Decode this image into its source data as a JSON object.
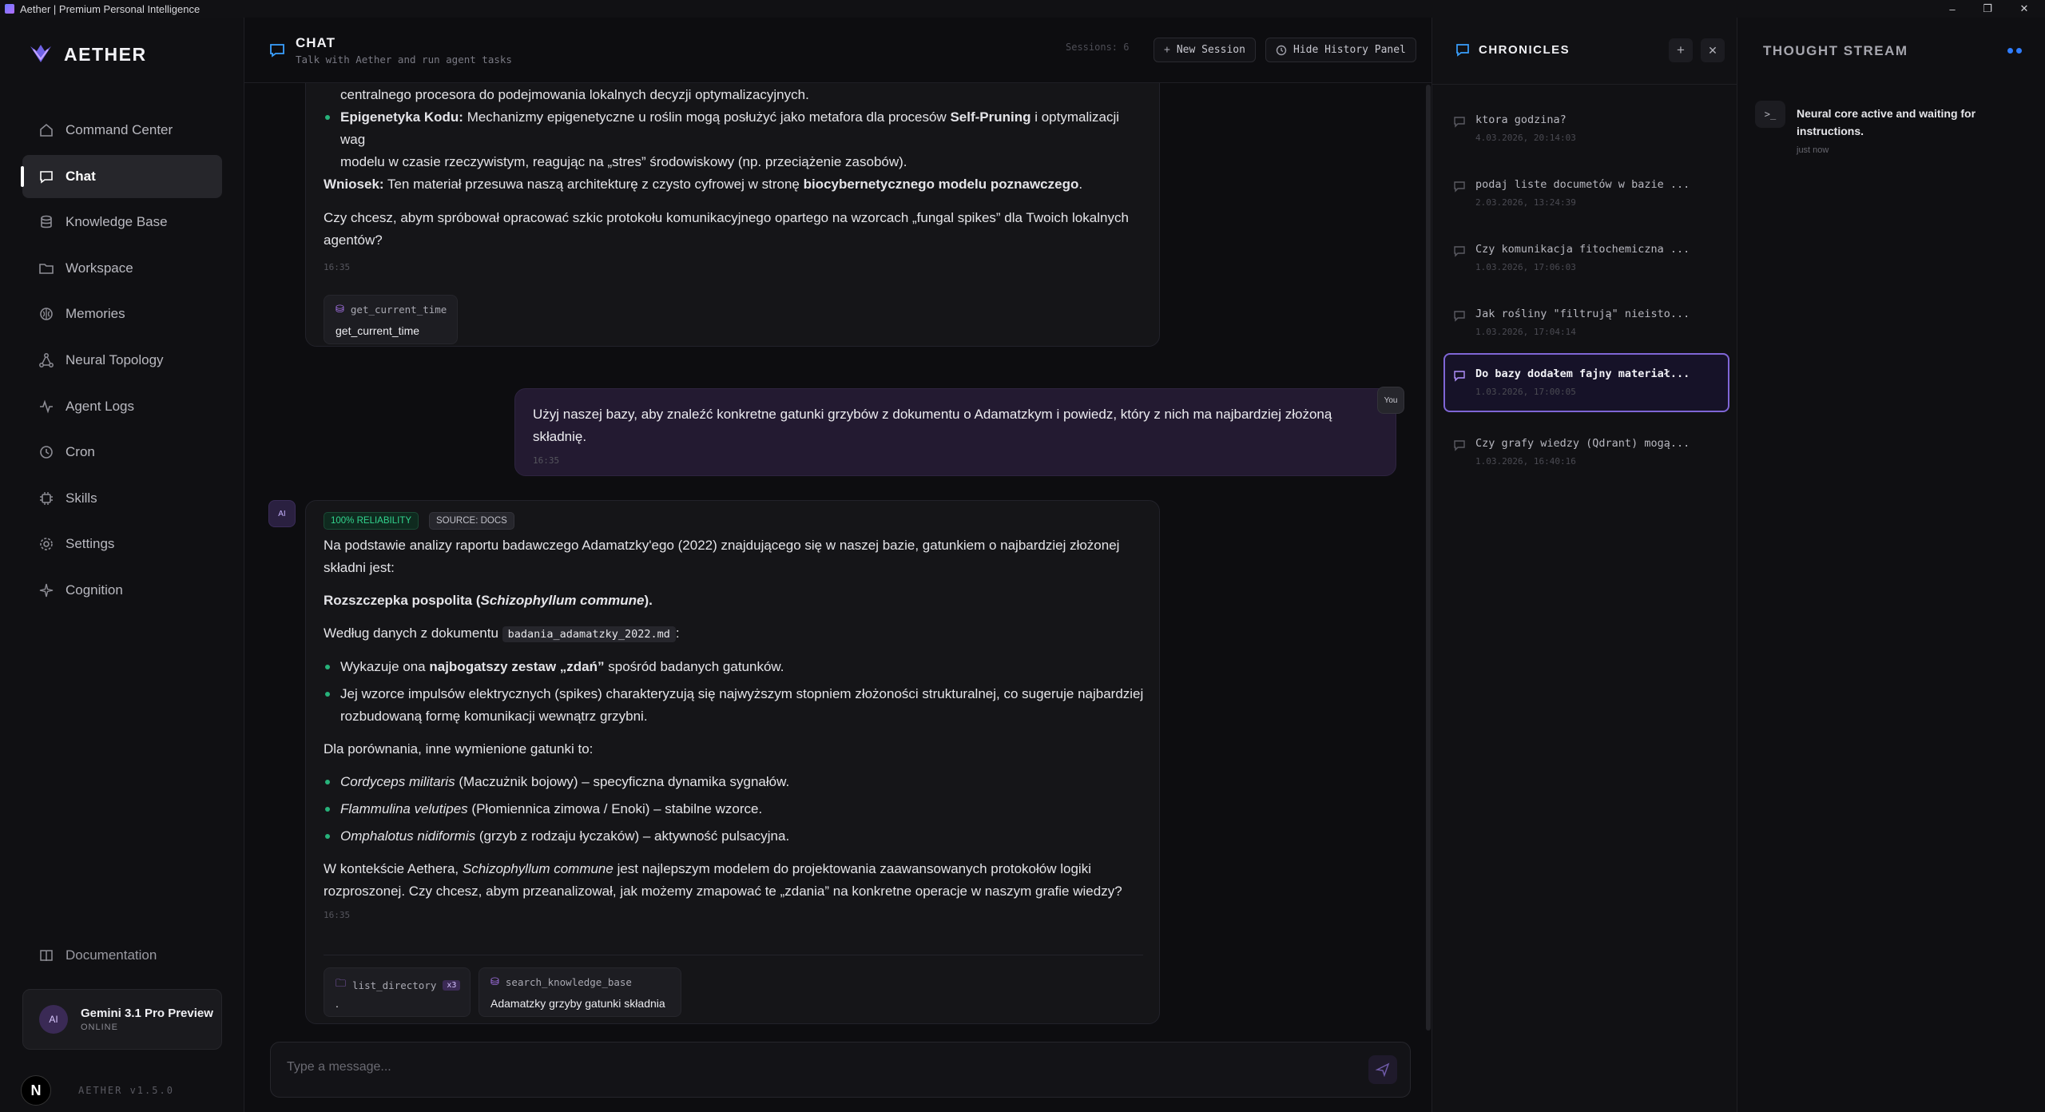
{
  "window": {
    "title": "Aether | Premium Personal Intelligence",
    "controls": [
      "–",
      "❐",
      "✕"
    ]
  },
  "sidebar": {
    "brand": "AETHER",
    "items": [
      {
        "label": "Command Center",
        "icon": "home-icon"
      },
      {
        "label": "Chat",
        "icon": "chat-icon",
        "active": true
      },
      {
        "label": "Knowledge Base",
        "icon": "database-icon"
      },
      {
        "label": "Workspace",
        "icon": "folder-icon"
      },
      {
        "label": "Memories",
        "icon": "brain-icon"
      },
      {
        "label": "Neural Topology",
        "icon": "network-icon"
      },
      {
        "label": "Agent Logs",
        "icon": "activity-icon"
      },
      {
        "label": "Cron",
        "icon": "clock-icon"
      },
      {
        "label": "Skills",
        "icon": "chip-icon"
      },
      {
        "label": "Settings",
        "icon": "gear-icon"
      },
      {
        "label": "Cognition",
        "icon": "sparkles-icon"
      }
    ],
    "documentation": "Documentation",
    "model": {
      "avatar": "AI",
      "name": "Gemini 3.1 Pro Preview",
      "status": "ONLINE"
    },
    "user_badge": "N",
    "version": "AETHER v1.5.0"
  },
  "chat": {
    "title": "CHAT",
    "subtitle": "Talk with Aether and run agent tasks",
    "sessions": "Sessions: 6",
    "new_session": "New Session",
    "hide_history": "Hide History Panel",
    "prev_message": {
      "line_top": "centralnego procesora do podejmowania lokalnych decyzji optymalizacyjnych.",
      "bullet_bold": "Epigenetyka Kodu:",
      "bullet_text_a": " Mechanizmy epigenetyczne u roślin mogą posłużyć jako metafora dla procesów ",
      "bullet_bold_2": "Self-Pruning",
      "bullet_text_b": " i optymalizacji wag",
      "bullet_line2": "modelu w czasie rzeczywistym, reagując na „stres” środowiskowy (np. przeciążenie zasobów).",
      "conclusion_label": "Wniosek:",
      "conclusion_text": " Ten materiał przesuwa naszą architekturę z czysto cyfrowej w stronę ",
      "conclusion_bold": "biocybernetycznego modelu poznawczego",
      "conclusion_end": ".",
      "question_1": "Czy chcesz, abym spróbował opracować szkic protokołu komunikacyjnego opartego na wzorcach „fungal spikes” dla Twoich lokalnych",
      "question_2": "agentów?",
      "time": "16:35",
      "tool": {
        "name": "get_current_time",
        "arg": "get_current_time"
      }
    },
    "user_message": {
      "avatar": "You",
      "line_1": "Użyj naszej bazy, aby znaleźć konkretne gatunki grzybów z dokumentu o Adamatzkym i powiedz, który z nich ma najbardziej złożoną",
      "line_2": "składnię.",
      "time": "16:35"
    },
    "ai_message": {
      "avatar": "AI",
      "tag_reliability": "100% RELIABILITY",
      "tag_source": "SOURCE: DOCS",
      "p1_l1": "Na podstawie analizy raportu badawczego Adamatzky'ego (2022) znajdującego się w naszej bazie, gatunkiem o najbardziej złożonej",
      "p1_l2": "składni jest:",
      "answer_bold": "Rozszczepka pospolita (",
      "answer_italic": "Schizophyllum commune",
      "answer_end": ").",
      "source_intro": "Według danych z dokumentu ",
      "source_file": "badania_adamatzky_2022.md",
      "source_colon": ":",
      "b1_a": "Wykazuje ona ",
      "b1_bold": "najbogatszy zestaw „zdań”",
      "b1_b": " spośród badanych gatunków.",
      "b2_l1": "Jej wzorce impulsów elektrycznych (spikes) charakteryzują się najwyższym stopniem złożoności strukturalnej, co sugeruje najbardziej",
      "b2_l2": "rozbudowaną formę komunikacji wewnątrz grzybni.",
      "comparison": "Dla porównania, inne wymienione gatunki to:",
      "species": [
        {
          "latin": "Cordyceps militaris",
          "desc": " (Maczużnik bojowy) – specyficzna dynamika sygnałów."
        },
        {
          "latin": "Flammulina velutipes",
          "desc": " (Płomiennica zimowa / Enoki) – stabilne wzorce."
        },
        {
          "latin": "Omphalotus nidiformis",
          "desc": " (grzyb z rodzaju łyczaków) – aktywność pulsacyjna."
        }
      ],
      "final_a": "W kontekście Aethera, ",
      "final_italic": "Schizophyllum commune",
      "final_b": " jest najlepszym modelem do projektowania zaawansowanych protokołów logiki",
      "final_l2": "rozproszonej. Czy chcesz, abym przeanalizował, jak możemy zmapować te „zdania” na konkretne operacje w naszym grafie wiedzy?",
      "time": "16:35",
      "tools": [
        {
          "name": "list_directory",
          "count": "x3",
          "arg": "."
        },
        {
          "name": "search_knowledge_base",
          "arg": "Adamatzky grzyby gatunki składnia"
        }
      ]
    },
    "composer_placeholder": "Type a message..."
  },
  "chronicles": {
    "title": "CHRONICLES",
    "add": "+",
    "close": "✕",
    "items": [
      {
        "title": "ktora godzina?",
        "date": "4.03.2026, 20:14:03"
      },
      {
        "title": "podaj liste documetów w bazie ...",
        "date": "2.03.2026, 13:24:39"
      },
      {
        "title": "Czy komunikacja fitochemiczna ...",
        "date": "1.03.2026, 17:06:03"
      },
      {
        "title": "Jak rośliny \"filtrują\" nieisto...",
        "date": "1.03.2026, 17:04:14"
      },
      {
        "title": "Do bazy dodałem fajny materiał...",
        "date": "1.03.2026, 17:00:05",
        "active": true
      },
      {
        "title": "Czy grafy wiedzy (Qdrant) mogą...",
        "date": "1.03.2026, 16:40:16"
      }
    ]
  },
  "thought_stream": {
    "title": "THOUGHT STREAM",
    "entry_icon": ">_",
    "entry_text": "Neural core active and waiting for instructions.",
    "entry_time": "just now"
  }
}
